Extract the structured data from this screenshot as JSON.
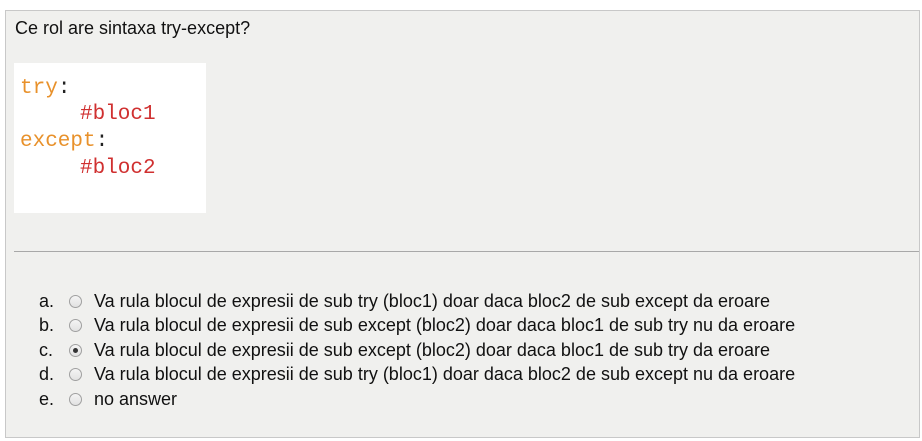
{
  "question": {
    "text": "Ce rol are sintaxa try-except?"
  },
  "code": {
    "lines": [
      {
        "keyword": "try",
        "punct": ":"
      },
      {
        "comment": "#bloc1"
      },
      {
        "keyword": "except",
        "punct": ":"
      },
      {
        "comment": "#bloc2"
      }
    ],
    "colors": {
      "keyword": "#e8912b",
      "comment": "#d03030"
    }
  },
  "answers": {
    "selected_index": 2,
    "options": [
      {
        "letter": "a.",
        "text": "Va rula blocul de expresii de sub try (bloc1) doar daca bloc2 de sub except da eroare",
        "checked": false
      },
      {
        "letter": "b.",
        "text": "Va rula blocul de expresii de sub except (bloc2) doar daca bloc1 de sub try nu da eroare",
        "checked": false
      },
      {
        "letter": "c.",
        "text": "Va rula blocul de expresii de sub except (bloc2) doar daca bloc1 de sub try da eroare",
        "checked": true
      },
      {
        "letter": "d.",
        "text": "Va rula blocul de expresii de sub try (bloc1) doar daca bloc2 de sub except nu da eroare",
        "checked": false
      },
      {
        "letter": "e.",
        "text": "no answer",
        "checked": false
      }
    ]
  }
}
